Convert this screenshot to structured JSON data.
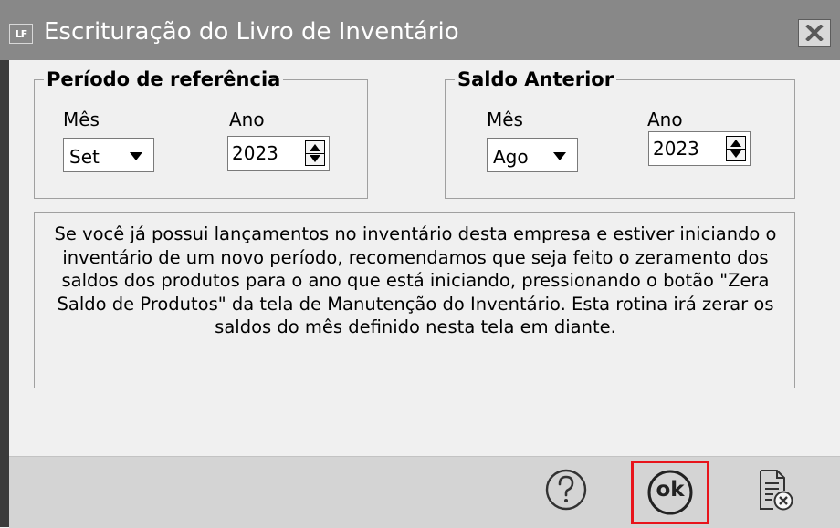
{
  "window": {
    "title": "Escrituração do Livro de Inventário",
    "icon_text": "LF",
    "close_icon": "close-x-icon"
  },
  "periodo": {
    "title": "Período de referência",
    "mes_label": "Mês",
    "mes_value": "Set",
    "ano_label": "Ano",
    "ano_value": "2023"
  },
  "saldo": {
    "title": "Saldo Anterior",
    "mes_label": "Mês",
    "mes_value": "Ago",
    "ano_label": "Ano",
    "ano_value": "2023"
  },
  "info": {
    "lines": [
      "Se você já possui lançamentos no inventário desta empresa e estiver iniciando o",
      "inventário de um novo período, recomendamos que seja feito o zeramento dos",
      "saldos dos produtos para o ano que está iniciando, pressionando o botão \"Zera",
      "Saldo de Produtos\" da tela de Manutenção do Inventário. Esta rotina irá zerar os",
      "saldos do mês definido nesta tela em diante."
    ]
  },
  "toolbar": {
    "help_icon": "question-circle-icon",
    "ok_label": "ok",
    "cancel_icon": "document-cancel-icon"
  },
  "colors": {
    "titlebar": "#888888",
    "highlight": "#e8141b"
  }
}
